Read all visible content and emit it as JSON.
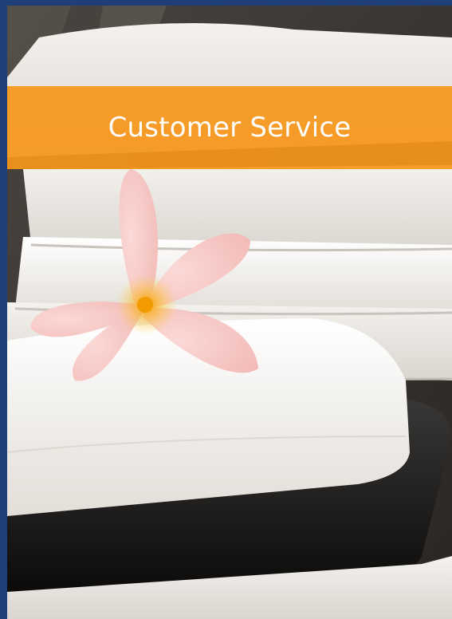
{
  "banner": {
    "title": "Customer Service"
  },
  "colors": {
    "frame": "#1f3f7a",
    "banner": "#f7961a",
    "banner_text": "#ffffff"
  },
  "image": {
    "subject": "spa towels with frangipani flower"
  }
}
